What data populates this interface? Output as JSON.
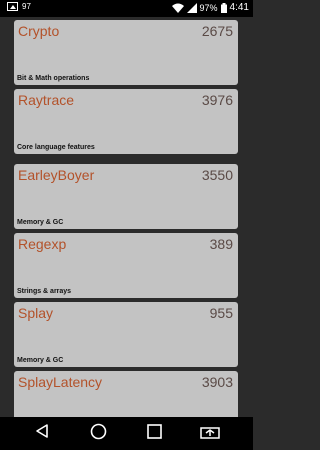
{
  "status": {
    "notif_text": "97",
    "battery": "97%",
    "time": "4:41"
  },
  "benchmarks": [
    {
      "name": "Crypto",
      "score": "2675",
      "category": "Bit & Math operations"
    },
    {
      "name": "Raytrace",
      "score": "3976",
      "category": "Core language features"
    },
    {
      "name": "EarleyBoyer",
      "score": "3550",
      "category": "Memory & GC"
    },
    {
      "name": "Regexp",
      "score": "389",
      "category": "Strings & arrays"
    },
    {
      "name": "Splay",
      "score": "955",
      "category": "Memory & GC"
    },
    {
      "name": "SplayLatency",
      "score": "3903",
      "category": ""
    }
  ],
  "icons": {
    "back": "back-icon",
    "home": "home-icon",
    "recents": "recents-icon",
    "screen_mirror": "screen-mirror-icon"
  }
}
